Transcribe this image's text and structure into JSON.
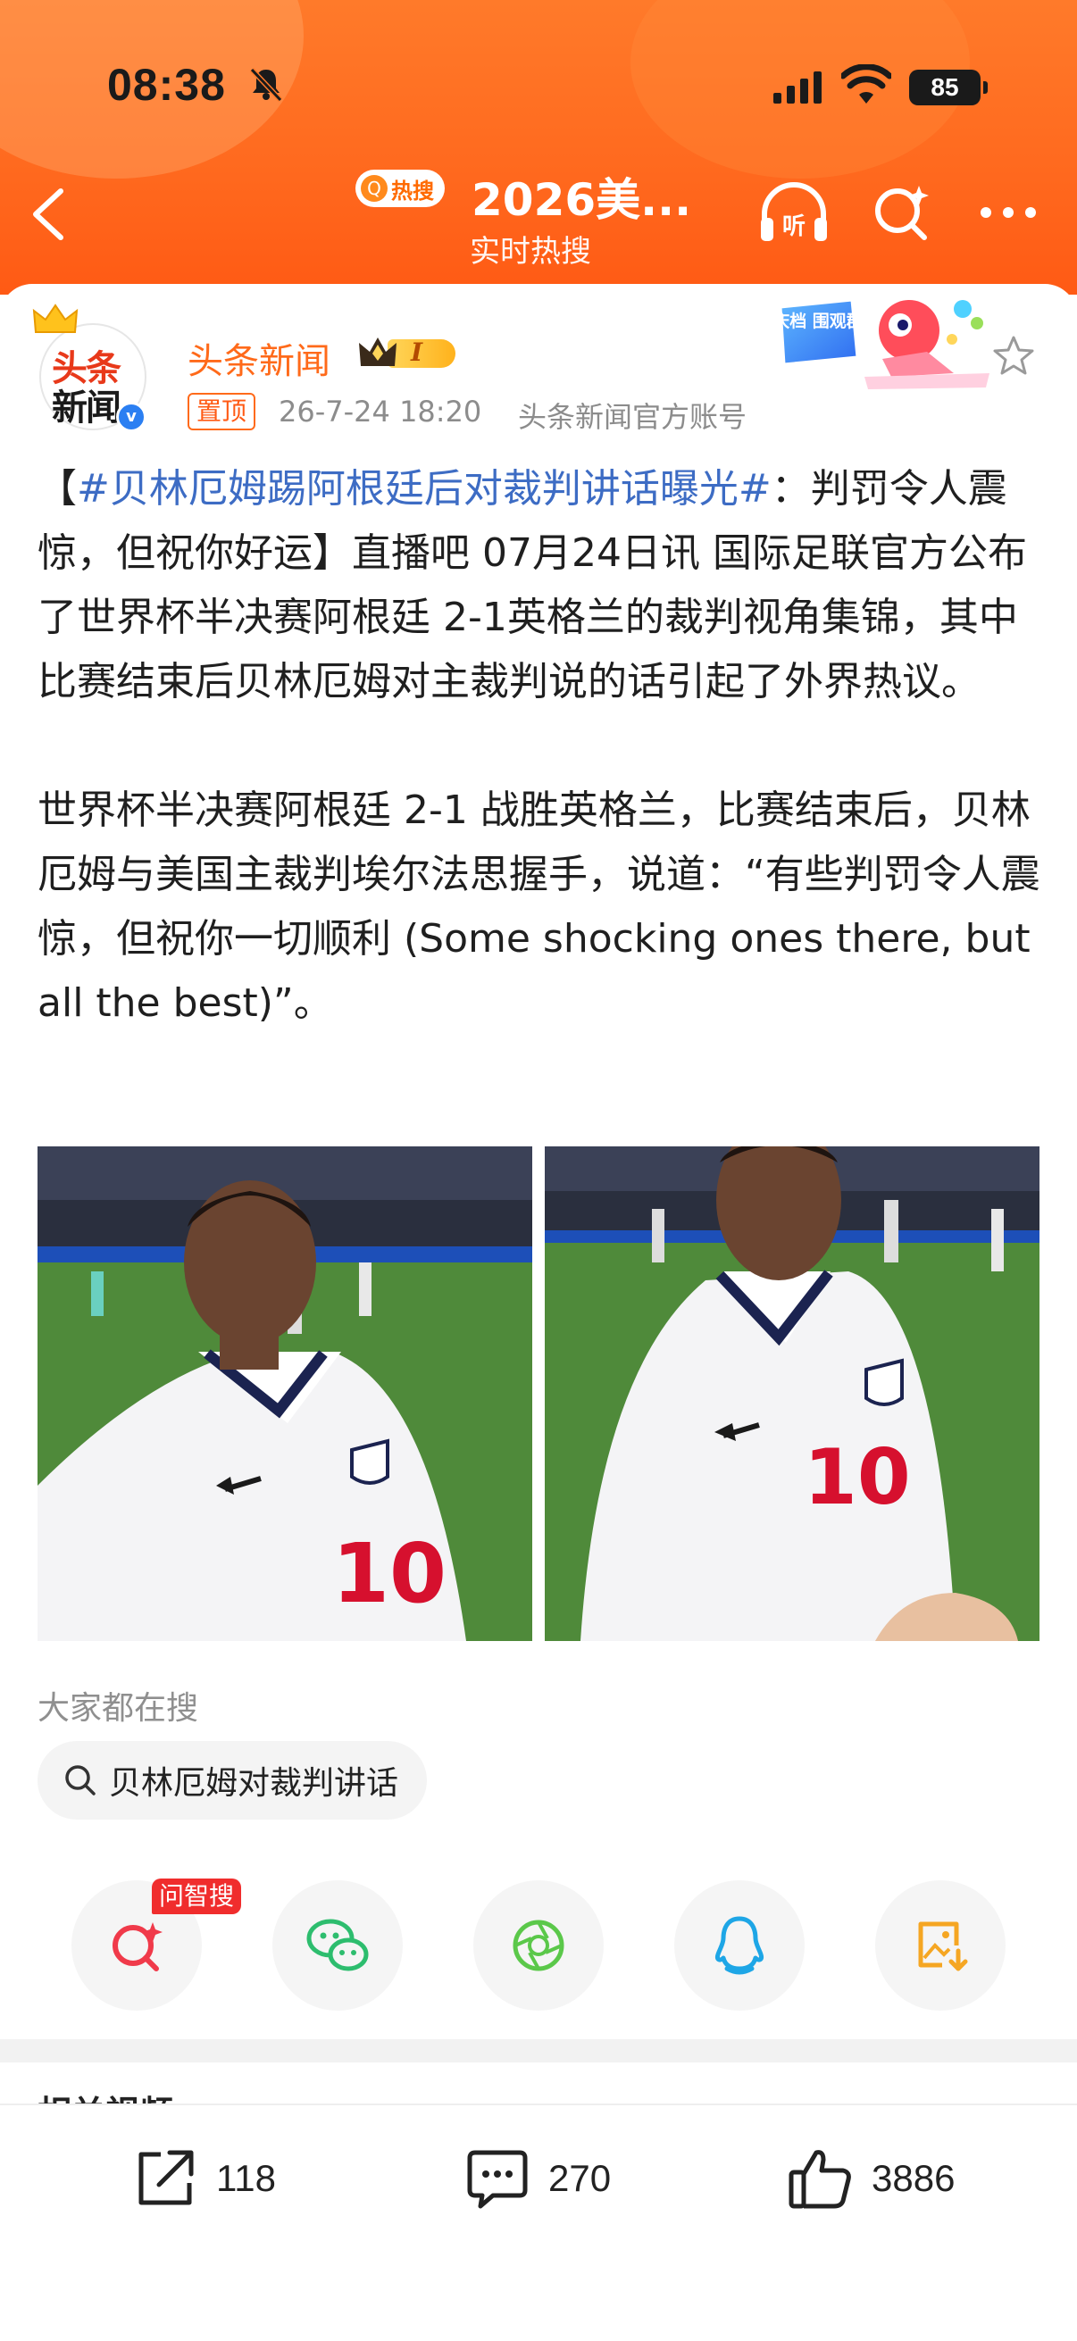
{
  "status_bar": {
    "time": "08:38",
    "battery": "85"
  },
  "nav": {
    "badge": "热搜",
    "title": "2026美...",
    "subtitle": "实时热搜"
  },
  "author": {
    "avatar_line1": "头条",
    "avatar_line2": "新闻",
    "name": "头条新闻",
    "level": "I",
    "pin_label": "置顶",
    "time": "26-7-24 18:20",
    "source": "头条新闻官方账号",
    "sticker_text": "国庆档 围观群众"
  },
  "article": {
    "bracket_open": "【",
    "topic": "#贝林厄姆踢阿根廷后对裁判讲话曝光#",
    "lead": "：判罚令人震惊，但祝你好运】直播吧 07月24日讯 国际足联官方公布了世界杯半决赛阿根廷 2-1英格兰的裁判视角集锦，其中比赛结束后贝林厄姆对主裁判说的话引起了外界热议。",
    "paragraph2": "世界杯半决赛阿根廷 2-1 战胜英格兰，比赛结束后，贝林厄姆与美国主裁判埃尔法思握手，说道：“有些判罚令人震惊，但祝你一切顺利 (Some shocking ones there, but all the best)”。"
  },
  "photos": {
    "jersey_number": "10"
  },
  "people_searching": {
    "title": "大家都在搜",
    "query": "贝林厄姆对裁判讲话"
  },
  "share": {
    "wenzhi_tag": "问智搜"
  },
  "related": {
    "title": "相关视频"
  },
  "actions": {
    "repost_count": "118",
    "comment_count": "270",
    "like_count": "3886"
  },
  "colors": {
    "header_orange": "#ff6a1f",
    "author_orange": "#ff6a1a",
    "topic_blue": "#3d6cc4",
    "wechat_green": "#2dbd6e",
    "qq_blue": "#1ea6e6",
    "save_orange": "#f5a623"
  }
}
